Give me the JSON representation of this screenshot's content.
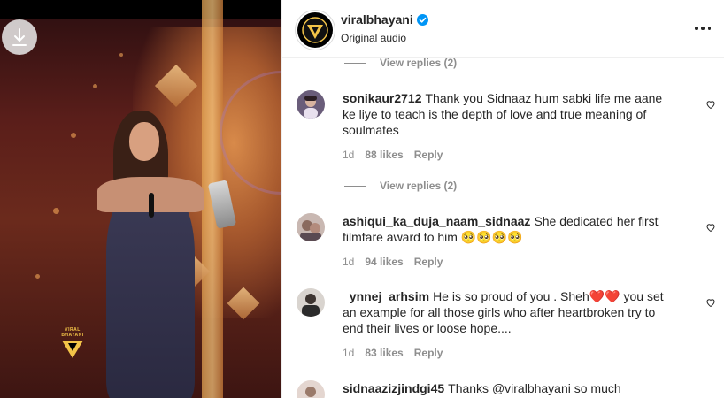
{
  "post": {
    "username": "viralbhayani",
    "verified": true,
    "audio_label": "Original audio",
    "brand_color": "#f3c448",
    "watermark_text": "VIRAL BHAYANI"
  },
  "comments_section": {
    "view_replies_top": "View replies (2)",
    "view_replies_mid": "View replies (2)",
    "comments": [
      {
        "username": "sonikaur2712",
        "text": "Thank you Sidnaaz hum sabki life me aane ke liye to teach is the depth of love and true meaning of soulmates",
        "age": "1d",
        "likes": "88 likes",
        "reply": "Reply"
      },
      {
        "username": "ashiqui_ka_duja_naam_sidnaaz",
        "text": "She dedicated her first filmfare award to him 🥺🥺🥺🥺",
        "age": "1d",
        "likes": "94 likes",
        "reply": "Reply"
      },
      {
        "username": "_ynnej_arhsim",
        "text": "He is so proud of you . Sheh❤️❤️ you set an example for all those girls who after heartbroken try to end their lives or loose hope....",
        "age": "1d",
        "likes": "83 likes",
        "reply": "Reply"
      },
      {
        "username": "sidnaazizjindgi45",
        "text": "Thanks @viralbhayani so much",
        "age": "",
        "likes": "",
        "reply": ""
      }
    ]
  },
  "icons": {
    "download": "download-icon",
    "verified": "verified-badge-icon",
    "more": "more-options-icon",
    "like": "heart-icon"
  }
}
